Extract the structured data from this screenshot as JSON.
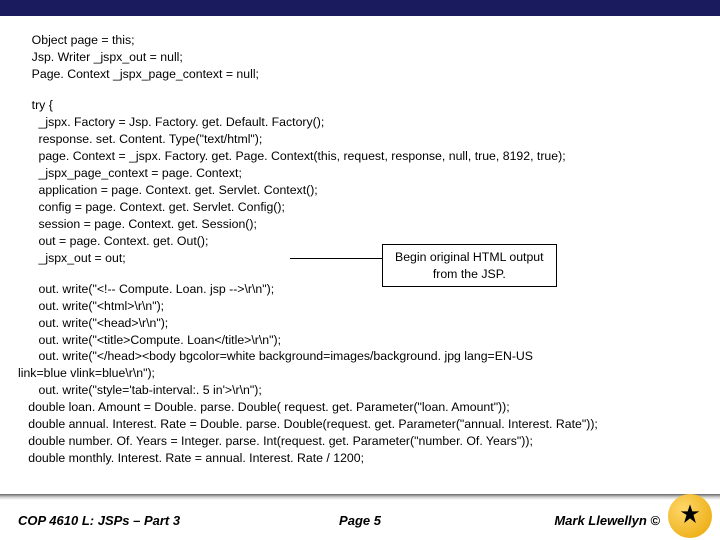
{
  "code": {
    "block1": "    Object page = this;\n    Jsp. Writer _jspx_out = null;\n    Page. Context _jspx_page_context = null;",
    "block2": "    try {\n      _jspx. Factory = Jsp. Factory. get. Default. Factory();\n      response. set. Content. Type(\"text/html\");\n      page. Context = _jspx. Factory. get. Page. Context(this, request, response, null, true, 8192, true);\n      _jspx_page_context = page. Context;\n      application = page. Context. get. Servlet. Context();\n      config = page. Context. get. Servlet. Config();\n      session = page. Context. get. Session();\n      out = page. Context. get. Out();\n      _jspx_out = out;",
    "block3": "      out. write(\"<!-- Compute. Loan. jsp -->\\r\\n\");\n      out. write(\"<html>\\r\\n\");\n      out. write(\"<head>\\r\\n\");\n      out. write(\"<title>Compute. Loan</title>\\r\\n\");\n      out. write(\"</head><body bgcolor=white background=images/background. jpg lang=EN-US\nlink=blue vlink=blue\\r\\n\");\n      out. write(\"style='tab-interval:. 5 in'>\\r\\n\");\n   double loan. Amount = Double. parse. Double( request. get. Parameter(\"loan. Amount\"));\n   double annual. Interest. Rate = Double. parse. Double(request. get. Parameter(\"annual. Interest. Rate\"));\n   double number. Of. Years = Integer. parse. Int(request. get. Parameter(\"number. Of. Years\"));\n   double monthly. Interest. Rate = annual. Interest. Rate / 1200;"
  },
  "callout": {
    "line1": "Begin original HTML output",
    "line2": "from the JSP."
  },
  "footer": {
    "left": "COP 4610 L: JSPs – Part 3",
    "center": "Page 5",
    "right": "Mark Llewellyn ©"
  }
}
